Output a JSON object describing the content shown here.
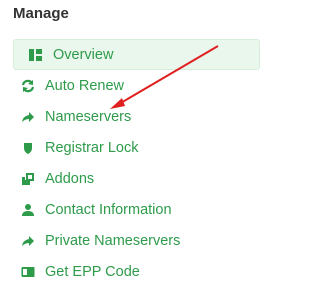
{
  "heading": "Manage",
  "menu": {
    "active_index": 0,
    "items": [
      {
        "label": "Overview",
        "icon": "dashboard-icon"
      },
      {
        "label": "Auto Renew",
        "icon": "sync-icon"
      },
      {
        "label": "Nameservers",
        "icon": "share-arrow-icon"
      },
      {
        "label": "Registrar Lock",
        "icon": "shield-icon"
      },
      {
        "label": "Addons",
        "icon": "addons-icon"
      },
      {
        "label": "Contact Information",
        "icon": "user-icon"
      },
      {
        "label": "Private Nameservers",
        "icon": "share-arrow-icon"
      },
      {
        "label": "Get EPP Code",
        "icon": "id-card-icon"
      }
    ]
  },
  "colors": {
    "accent": "#2e9b4b",
    "active_bg": "#eaf7ec",
    "heading": "#333333",
    "annotation_arrow": "#e02020"
  }
}
